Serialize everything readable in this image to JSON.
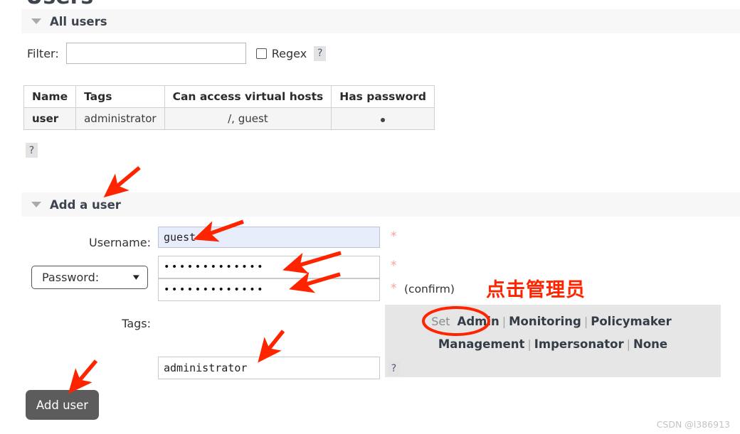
{
  "page": {
    "title": "Users",
    "watermark": "CSDN @l386913"
  },
  "all_users_section": {
    "header": "All users",
    "collapse_icon": "triangle-down-icon",
    "filter": {
      "label": "Filter:",
      "value": "",
      "placeholder": "",
      "regex_label": "Regex",
      "regex_checked": false,
      "hint": "?"
    },
    "table": {
      "columns": [
        "Name",
        "Tags",
        "Can access virtual hosts",
        "Has password"
      ],
      "rows": [
        {
          "name": "user",
          "tags": "administrator",
          "vhosts": "/, guest",
          "has_password": "●"
        }
      ],
      "hint": "?"
    }
  },
  "add_user_section": {
    "header": "Add a user",
    "collapse_icon": "triangle-down-icon",
    "username": {
      "label": "Username:",
      "value": "guest",
      "required_marker": "*"
    },
    "password": {
      "select_label": "Password:",
      "select_icon": "chevron-down-icon",
      "value": "•••••••••••••",
      "confirm_value": "•••••••••••••",
      "required_marker": "*",
      "confirm_required_marker": "*",
      "confirm_text": "(confirm)"
    },
    "tags": {
      "label": "Tags:",
      "value": "administrator",
      "set_word": "Set",
      "links": [
        "Admin",
        "Monitoring",
        "Policymaker",
        "Management",
        "Impersonator",
        "None"
      ],
      "separator": "|",
      "hint": "?"
    },
    "submit_button": "Add user"
  },
  "annotations": {
    "chinese_note": "点击管理员",
    "highlight_color": "#ff2400",
    "circled_target": "Admin",
    "arrows": [
      {
        "name": "arrow-to-add-a-user-section"
      },
      {
        "name": "arrow-to-username-field"
      },
      {
        "name": "arrow-to-password-field"
      },
      {
        "name": "arrow-to-confirm-password-field"
      },
      {
        "name": "arrow-to-tags-field"
      },
      {
        "name": "arrow-to-add-user-button"
      }
    ]
  },
  "colors": {
    "section_bar_bg": "#f7f7f7",
    "table_row_bg": "#f5f5f5",
    "tags_panel_bg": "#e6e6e6",
    "focused_input_bg": "#e8edfb",
    "button_bg": "#5c5c5c",
    "annotation_red": "#ff2400"
  }
}
